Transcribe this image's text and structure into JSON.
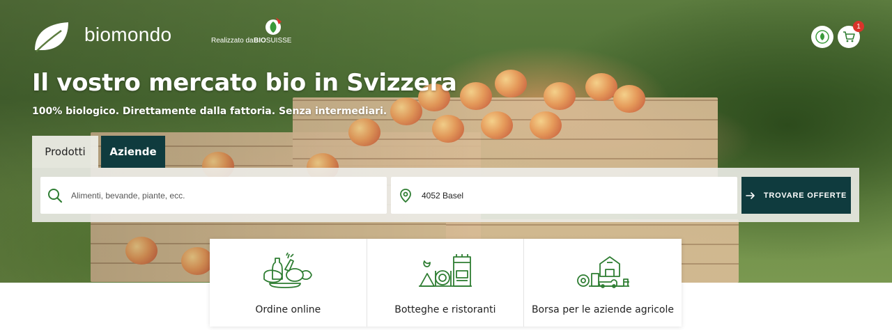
{
  "header": {
    "brand": "biomondo",
    "made_by_prefix": "Realizzato da",
    "made_by_bio": "BIO",
    "made_by_suisse": "SUISSE",
    "cart_count": "1"
  },
  "hero": {
    "headline": "Il vostro mercato bio in Svizzera",
    "subline": "100% biologico. Direttamente dalla fattoria. Senza intermediari."
  },
  "tabs": [
    {
      "label": "Prodotti",
      "active": true
    },
    {
      "label": "Aziende",
      "active": false
    }
  ],
  "search": {
    "product_placeholder": "Alimenti, bevande, piante, ecc.",
    "location_value": "4052 Basel",
    "submit_label": "TROVARE OFFERTE"
  },
  "categories": [
    {
      "label": "Ordine online",
      "icon": "groceries-icon"
    },
    {
      "label": "Botteghe e ristoranti",
      "icon": "shop-restaurant-icon"
    },
    {
      "label": "Borsa per le aziende agricole",
      "icon": "farm-icon"
    }
  ],
  "colors": {
    "primary_dark": "#0f3b3e",
    "icon_green": "#2e7d32",
    "badge_red": "#d9342b"
  }
}
